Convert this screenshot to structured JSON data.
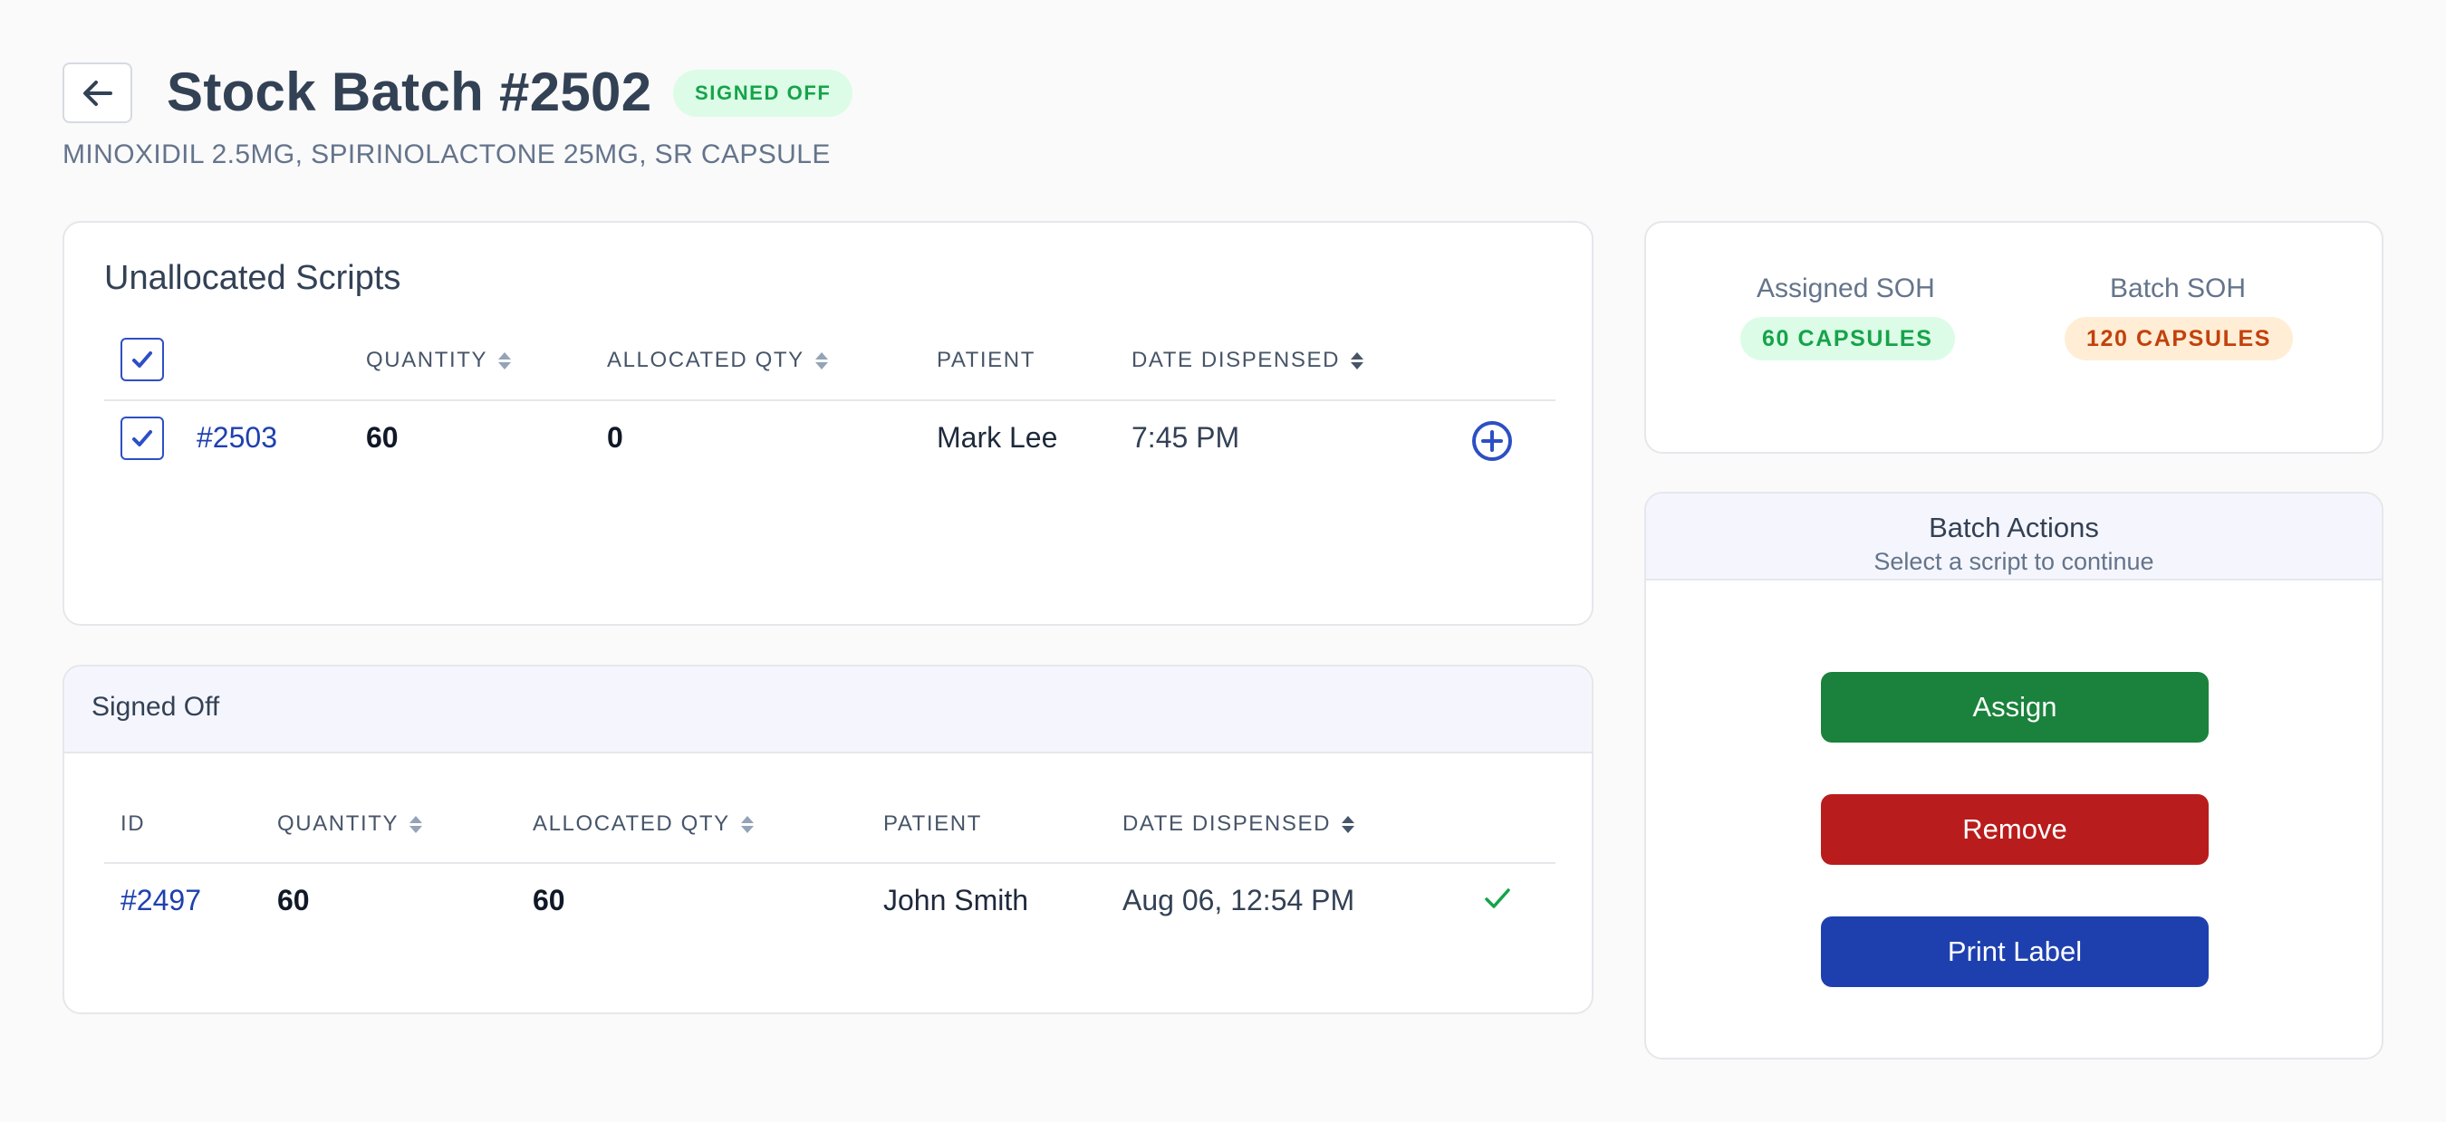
{
  "header": {
    "title": "Stock Batch #2502",
    "status": "SIGNED OFF",
    "subtitle": "MINOXIDIL 2.5MG, SPIRINOLACTONE 25MG, SR CAPSULE"
  },
  "unallocated": {
    "title": "Unallocated Scripts",
    "columns": {
      "quantity": "QUANTITY",
      "allocated": "ALLOCATED QTY",
      "patient": "PATIENT",
      "date": "DATE DISPENSED"
    },
    "rows": [
      {
        "id": "#2503",
        "quantity": "60",
        "allocated": "0",
        "patient": "Mark Lee",
        "date": "7:45 PM",
        "checked": true
      }
    ]
  },
  "signed_off": {
    "title": "Signed Off",
    "columns": {
      "id": "ID",
      "quantity": "QUANTITY",
      "allocated": "ALLOCATED QTY",
      "patient": "PATIENT",
      "date": "DATE DISPENSED"
    },
    "rows": [
      {
        "id": "#2497",
        "quantity": "60",
        "allocated": "60",
        "patient": "John Smith",
        "date": "Aug 06, 12:54 PM"
      }
    ]
  },
  "soh": {
    "assigned_label": "Assigned SOH",
    "assigned_value": "60 CAPSULES",
    "batch_label": "Batch SOH",
    "batch_value": "120 CAPSULES"
  },
  "actions": {
    "title": "Batch Actions",
    "subtitle": "Select a script to continue",
    "assign": "Assign",
    "remove": "Remove",
    "print": "Print Label"
  },
  "colors": {
    "assign": "#1a823c",
    "remove": "#b91c1c",
    "print": "#1e40af",
    "status_badge_bg": "#dcfce7",
    "status_badge_text": "#16a34a"
  },
  "icons": {
    "back": "arrow-left-icon",
    "add": "plus-circle-icon",
    "signed": "check-icon",
    "checkbox": "check-icon",
    "sort": "sort-icon"
  }
}
